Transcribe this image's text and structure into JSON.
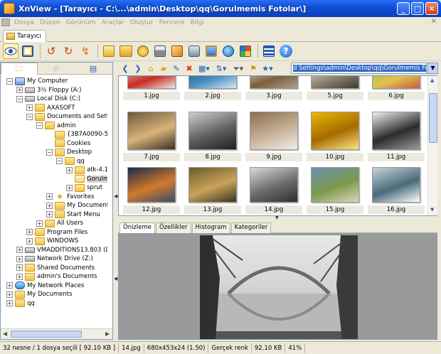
{
  "window": {
    "title": "XnView - [Tarayıcı - C:\\...\\admin\\Desktop\\qq\\Gorulmemis Fotolar\\]",
    "controls": [
      "_",
      "□",
      "✕"
    ]
  },
  "menu": {
    "items": [
      "Dosya",
      "Düzen",
      "Görünüm",
      "Araçlar",
      "Oluştur",
      "Pencere",
      "Bilgi"
    ],
    "close_glyph": "✕"
  },
  "tab": {
    "label": "Tarayıcı"
  },
  "toolbar": {
    "icons": [
      "browser-view-icon",
      "fullscreen-icon",
      "rotate-left-icon",
      "rotate-right-icon",
      "flip-icon",
      "open-folder-icon",
      "browse-folder-icon",
      "properties-icon",
      "print-icon",
      "convert-icon",
      "capture-icon",
      "slideshow-icon",
      "globe-icon",
      "mosaic-icon",
      "settings-icon",
      "help-icon"
    ]
  },
  "tree": {
    "nodes": [
      {
        "label": "My Computer",
        "level": 0,
        "pm": "-",
        "icon": "computer"
      },
      {
        "label": "3½ Floppy (A:)",
        "level": 1,
        "pm": "+",
        "icon": "drive"
      },
      {
        "label": "Local Disk (C:)",
        "level": 1,
        "pm": "-",
        "icon": "drive"
      },
      {
        "label": "AXASOFT",
        "level": 2,
        "pm": "+",
        "icon": "folder"
      },
      {
        "label": "Documents and Settings",
        "level": 2,
        "pm": "-",
        "icon": "folder"
      },
      {
        "label": "admin",
        "level": 3,
        "pm": "-",
        "icon": "folder"
      },
      {
        "label": "{3B7A0090-5AE",
        "level": 4,
        "pm": "",
        "icon": "folder"
      },
      {
        "label": "Cookies",
        "level": 4,
        "pm": "",
        "icon": "folder"
      },
      {
        "label": "Desktop",
        "level": 4,
        "pm": "-",
        "icon": "folder"
      },
      {
        "label": "qq",
        "level": 5,
        "pm": "-",
        "icon": "folder"
      },
      {
        "label": "atk-4.1",
        "level": 6,
        "pm": "+",
        "icon": "folder"
      },
      {
        "label": "Gorulme",
        "level": 6,
        "pm": "",
        "icon": "folder-open",
        "selected": true
      },
      {
        "label": "sprut",
        "level": 6,
        "pm": "+",
        "icon": "folder"
      },
      {
        "label": "Favorites",
        "level": 4,
        "pm": "+",
        "icon": "star"
      },
      {
        "label": "My Documents",
        "level": 4,
        "pm": "+",
        "icon": "folder"
      },
      {
        "label": "Start Menu",
        "level": 4,
        "pm": "+",
        "icon": "folder"
      },
      {
        "label": "All Users",
        "level": 3,
        "pm": "+",
        "icon": "folder"
      },
      {
        "label": "Program Files",
        "level": 2,
        "pm": "+",
        "icon": "folder"
      },
      {
        "label": "WINDOWS",
        "level": 2,
        "pm": "+",
        "icon": "folder"
      },
      {
        "label": "VMADDITIONS13.803 (D:)",
        "level": 1,
        "pm": "+",
        "icon": "drive"
      },
      {
        "label": "Network Drive (Z:)",
        "level": 1,
        "pm": "+",
        "icon": "drive"
      },
      {
        "label": "Shared Documents",
        "level": 1,
        "pm": "+",
        "icon": "folder"
      },
      {
        "label": "admin's Documents",
        "level": 1,
        "pm": "+",
        "icon": "folder"
      },
      {
        "label": "My Network Places",
        "level": 0,
        "pm": "+",
        "icon": "net"
      },
      {
        "label": "My Documents",
        "level": 0,
        "pm": "+",
        "icon": "folder"
      },
      {
        "label": "qq",
        "level": 0,
        "pm": "+",
        "icon": "folder"
      }
    ]
  },
  "address": {
    "value": "d Settings\\admin\\Desktop\\qq\\Gorulmemis Fotolar\\"
  },
  "thumbnails": [
    {
      "label": "1.jpg",
      "colors": [
        "#c9c6bd",
        "#c92b23",
        "#efe8e2"
      ]
    },
    {
      "label": "2.jpg",
      "colors": [
        "#1e4d7a",
        "#4a8fc4",
        "#d8e6f0"
      ]
    },
    {
      "label": "3.jpg",
      "colors": [
        "#d9d4c7",
        "#7d5e3b",
        "#a8a08c"
      ]
    },
    {
      "label": "5.jpg",
      "colors": [
        "#e7e4dd",
        "#8a7d6b",
        "#3f3a34"
      ]
    },
    {
      "label": "6.jpg",
      "colors": [
        "#8fbf5a",
        "#e2c24f",
        "#c85a3d"
      ]
    },
    {
      "label": "7.jpg",
      "colors": [
        "#6b5a3a",
        "#d8b37a",
        "#3d2f22"
      ]
    },
    {
      "label": "8.jpg",
      "colors": [
        "#cfcfcf",
        "#5f5f5f",
        "#1f1f1f"
      ]
    },
    {
      "label": "9.jpg",
      "colors": [
        "#8a6d50",
        "#c7b39a",
        "#f0ede8"
      ]
    },
    {
      "label": "10.jpg",
      "colors": [
        "#e6b800",
        "#a66b00",
        "#ffe680"
      ]
    },
    {
      "label": "11.jpg",
      "colors": [
        "#f0f0f0",
        "#2b2b2b",
        "#9a9a9a"
      ]
    },
    {
      "label": "12.jpg",
      "colors": [
        "#1a2a4a",
        "#d27a2c",
        "#3a4a6a"
      ]
    },
    {
      "label": "13.jpg",
      "colors": [
        "#6a5a2a",
        "#c9a35a",
        "#3a3520"
      ]
    },
    {
      "label": "14.jpg",
      "colors": [
        "#d9d9d9",
        "#6b6b6b",
        "#2e2e2e"
      ]
    },
    {
      "label": "15.jpg",
      "colors": [
        "#6a8fb5",
        "#7c9a4a",
        "#e0d5b8"
      ]
    },
    {
      "label": "16.jpg",
      "colors": [
        "#c8d3d9",
        "#4a6a7a",
        "#ffffff"
      ]
    }
  ],
  "preview": {
    "tabs": [
      "Önizleme",
      "Özellikler",
      "Histogram",
      "Kategoriler"
    ],
    "active_tab": 0
  },
  "status": {
    "items": [
      "32 nesne / 1 dosya seçili  [ 92.10 KB ]",
      "14.jpg",
      "680x453x24 (1.50)",
      "Gerçek renk",
      "92.10 KB",
      "41%"
    ]
  }
}
